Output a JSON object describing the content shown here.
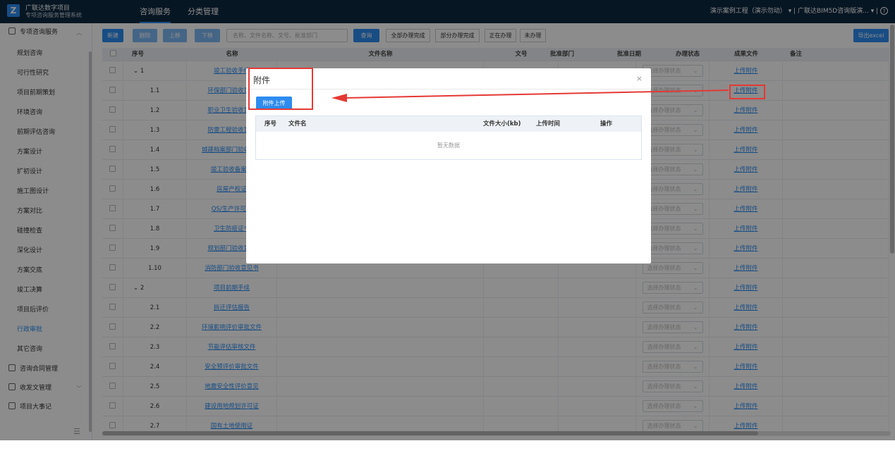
{
  "app": {
    "logo": "Z",
    "name": "广联达数字项目",
    "subtitle": "专项咨询服务管理系统"
  },
  "nav": {
    "tabs": [
      "咨询服务",
      "分类管理"
    ]
  },
  "topright": {
    "project": "演示案例工程（演示勿动）",
    "org": "广联达BIM5D咨询版演...",
    "help": "?"
  },
  "sidebar": {
    "group1": "专项咨询服务",
    "items": [
      "规划咨询",
      "可行性研究",
      "项目前期策划",
      "环境咨询",
      "前期评估咨询",
      "方案设计",
      "扩初设计",
      "施工图设计",
      "方案对比",
      "碰撞检查",
      "深化设计",
      "方案交底",
      "竣工决算",
      "项目后评价",
      "行政审批",
      "其它咨询"
    ],
    "active_item": "行政审批",
    "group2": "咨询合同管理",
    "group3": "收发文管理",
    "group4": "项目大事记"
  },
  "toolbar": {
    "new": "新建",
    "delete": "删除",
    "up": "上移",
    "down": "下移",
    "search_placeholder": "名称、文件名称、文号、批准部门",
    "query": "查询",
    "all_done": "全部办理完成",
    "partial_done": "部分办理完成",
    "in_progress": "正在办理",
    "not_done": "未办理",
    "export": "导出excel"
  },
  "table": {
    "headers": [
      "序号",
      "名称",
      "文件名称",
      "文号",
      "批准部门",
      "批准日期",
      "办理状态",
      "成果文件",
      "备注"
    ],
    "status_placeholder": "选择办理状态",
    "upload_label": "上传附件",
    "rows": [
      {
        "no": "1",
        "name": "竣工验收手续",
        "group": true
      },
      {
        "no": "1.1",
        "name": "环保部门验收意见"
      },
      {
        "no": "1.2",
        "name": "职业卫生验收意见"
      },
      {
        "no": "1.3",
        "name": "防雷工程验收意见"
      },
      {
        "no": "1.4",
        "name": "城建档案部门验收意见"
      },
      {
        "no": "1.5",
        "name": "竣工验收备案表"
      },
      {
        "no": "1.6",
        "name": "房屋产权证"
      },
      {
        "no": "1.7",
        "name": "QS/生产许可证"
      },
      {
        "no": "1.8",
        "name": "卫生防疫证书"
      },
      {
        "no": "1.9",
        "name": "规划部门验收意见"
      },
      {
        "no": "1.10",
        "name": "消防部门验收意见书"
      },
      {
        "no": "2",
        "name": "项目前期手续",
        "group": true
      },
      {
        "no": "2.1",
        "name": "拆迁评估报告"
      },
      {
        "no": "2.2",
        "name": "环境影响评价审批文件"
      },
      {
        "no": "2.3",
        "name": "节能评估审核文件"
      },
      {
        "no": "2.4",
        "name": "安全预评价审批文件"
      },
      {
        "no": "2.5",
        "name": "地震安全性评价意见"
      },
      {
        "no": "2.6",
        "name": "建设用地规划许可证"
      },
      {
        "no": "2.7",
        "name": "国有土地使用证"
      }
    ]
  },
  "modal": {
    "title": "附件",
    "close": "×",
    "upload_button": "附件上传",
    "headers": [
      "序号",
      "文件名",
      "文件大小(kb)",
      "上传时间",
      "操作"
    ],
    "empty": "暂无数据"
  },
  "annotation": {
    "color": "#e53935"
  }
}
